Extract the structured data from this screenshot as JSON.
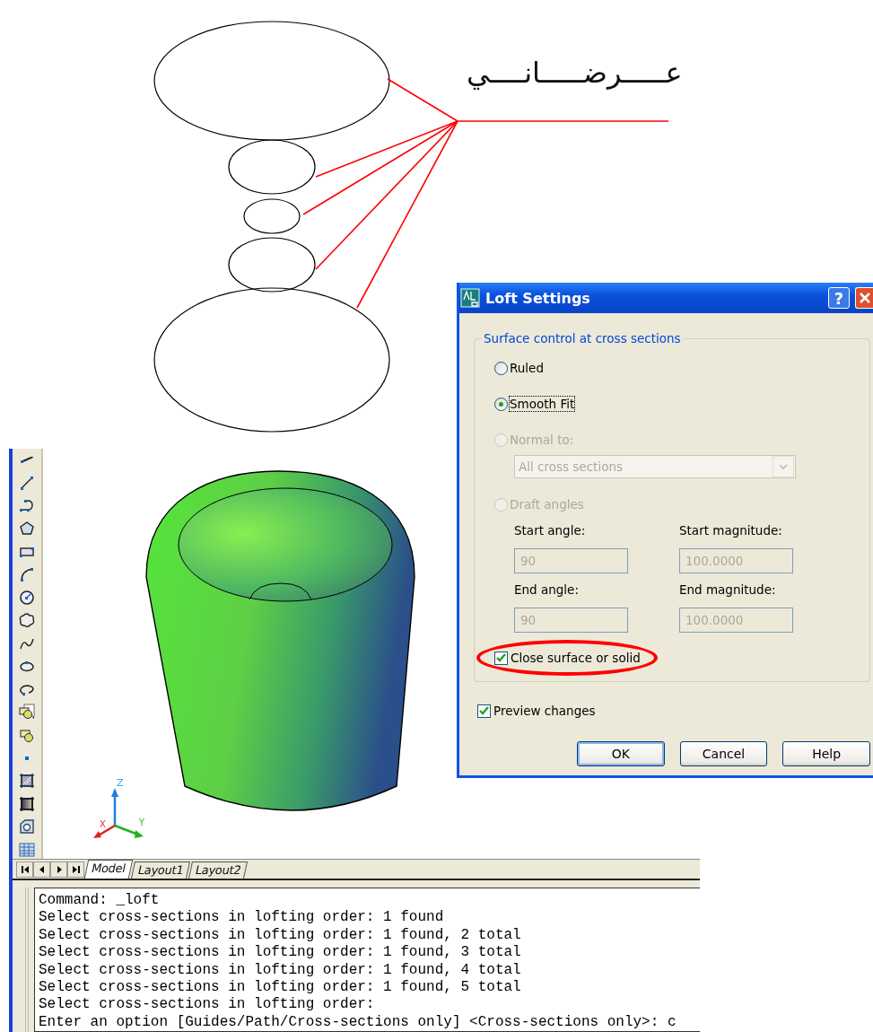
{
  "sketch": {
    "label": "عـــــرضـــــانــــي"
  },
  "cad": {
    "axis_labels": [
      "Z",
      "X",
      "Y"
    ],
    "tabs": [
      {
        "label": "Model",
        "selected": true
      },
      {
        "label": "Layout1",
        "selected": false
      },
      {
        "label": "Layout2",
        "selected": false
      }
    ],
    "command_lines": [
      "Command: _loft",
      "Select cross-sections in lofting order: 1 found",
      "Select cross-sections in lofting order: 1 found, 2 total",
      "Select cross-sections in lofting order: 1 found, 3 total",
      "Select cross-sections in lofting order: 1 found, 4 total",
      "Select cross-sections in lofting order: 1 found, 5 total",
      "Select cross-sections in lofting order:",
      "Enter an option [Guides/Path/Cross-sections only] <Cross-sections only>: c"
    ]
  },
  "dialog": {
    "title": "Loft Settings",
    "help_glyph": "?",
    "group_label": "Surface control at cross sections",
    "options": [
      {
        "label": "Ruled",
        "selected": false,
        "disabled": false
      },
      {
        "label": "Smooth Fit",
        "selected": true,
        "disabled": false
      },
      {
        "label": "Normal to:",
        "selected": false,
        "disabled": true
      },
      {
        "label": "Draft angles",
        "selected": false,
        "disabled": true
      }
    ],
    "dropdown": {
      "value": "All cross sections",
      "disabled": true
    },
    "fields": [
      {
        "label": "Start angle:",
        "value": "90",
        "disabled": true
      },
      {
        "label": "Start magnitude:",
        "value": "100.0000",
        "disabled": true
      },
      {
        "label": "End angle:",
        "value": "90",
        "disabled": true
      },
      {
        "label": "End magnitude:",
        "value": "100.0000",
        "disabled": true
      }
    ],
    "close_surface": {
      "label": "Close surface or solid",
      "checked": true,
      "highlighted": true
    },
    "preview": {
      "label": "Preview changes",
      "checked": true
    },
    "buttons": [
      "OK",
      "Cancel",
      "Help"
    ]
  }
}
